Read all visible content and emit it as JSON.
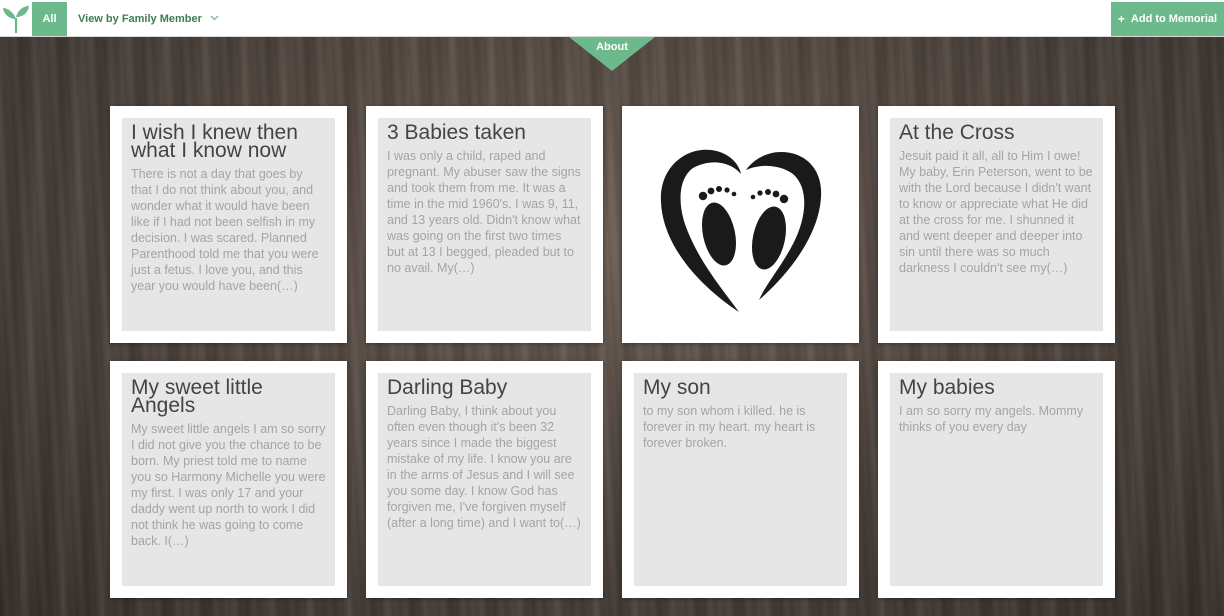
{
  "topbar": {
    "all_label": "All",
    "view_by_label": "View by Family Member",
    "add_label": "Add to Memorial",
    "about_label": "About",
    "accent_color": "#6cb98b"
  },
  "cards": [
    {
      "title": "I wish I knew then what I know now",
      "excerpt": "There is not a day that goes by that I do not think about you, and wonder what it would have been like if I had not been selfish in my decision. I was scared. Planned Parenthood told me that you were just a fetus. I love you, and this year you would have been(…)"
    },
    {
      "title": "3 Babies taken",
      "excerpt": "I was only a child, raped and pregnant. My abuser saw the signs and took them from me. It was a time in the mid 1960's. I was 9, 11, and 13 years old. Didn't know what was going on the first two times but at 13 I begged, pleaded but to no avail. My(…)"
    },
    {
      "image": "heart-footprints-image"
    },
    {
      "title": "At the Cross",
      "excerpt": "Jesuit paid it all, all to Him I owe! My baby, Erin Peterson, went to be with the Lord because I didn't want to know or appreciate what He did at the cross for me. I shunned it and went deeper and deeper into sin until there was so much darkness I couldn't see my(…)"
    },
    {
      "title": "My sweet little Angels",
      "excerpt": "My sweet little angels I am so sorry I did not give you the chance to be born. My priest told me to name you so Harmony Michelle you were my first. I was only 17 and your daddy went up north to work I did not think he was going to come back. I(…)"
    },
    {
      "title": "Darling Baby",
      "excerpt": "Darling Baby, I think about you often even though it's been 32 years since I made the biggest mistake of my life. I know you are in the arms of Jesus and I will see you some day. I know God has forgiven me, I've forgiven myself (after a long time) and I want to(…)"
    },
    {
      "title": "My son",
      "excerpt": "to my son whom i killed. he is forever in my heart. my heart is forever broken."
    },
    {
      "title": "My babies",
      "excerpt": "I am so sorry my angels. Mommy thinks of you every day"
    }
  ]
}
